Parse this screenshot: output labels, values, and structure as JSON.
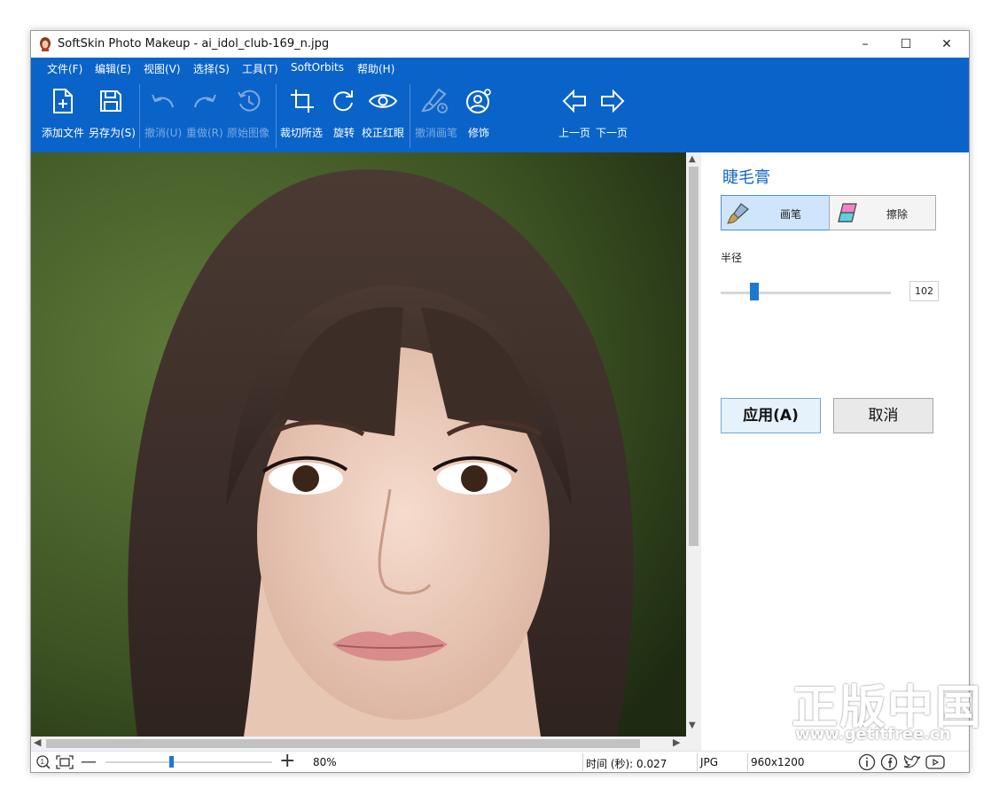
{
  "window": {
    "title": "SoftSkin Photo Makeup - ai_idol_club-169_n.jpg",
    "controls": {
      "minimize": "–",
      "maximize": "☐",
      "close": "✕"
    }
  },
  "menu": [
    "文件(F)",
    "编辑(E)",
    "视图(V)",
    "选择(S)",
    "工具(T)",
    "SoftOrbits",
    "帮助(H)"
  ],
  "toolbar": {
    "add_file": "添加文件",
    "save_as": "另存为(S)",
    "undo": "撤消(U)",
    "redo": "重做(R)",
    "original": "原始图像",
    "crop": "裁切所选",
    "rotate": "旋转",
    "redeye": "校正红眼",
    "undo_brush": "撤消画笔",
    "retouch": "修饰",
    "prev": "上一页",
    "next": "下一页"
  },
  "panel": {
    "title": "睫毛膏",
    "brush_label": "画笔",
    "erase_label": "擦除",
    "radius_label": "半径",
    "radius_value": "102",
    "radius_fraction": 0.2,
    "apply_label": "应用(A)",
    "cancel_label": "取消"
  },
  "status": {
    "zoom": "80%",
    "zoom_fraction": 0.4,
    "time": "时间 (秒): 0.027",
    "format": "JPG",
    "size": "960x1200"
  },
  "watermark": {
    "line1": "正版中国",
    "line2": "www.getitfree.cn"
  },
  "colors": {
    "accent": "#0a63c9",
    "panel_title": "#1567c7",
    "selected_segment": "#cfe5fb",
    "slider_thumb": "#1e78d2"
  }
}
